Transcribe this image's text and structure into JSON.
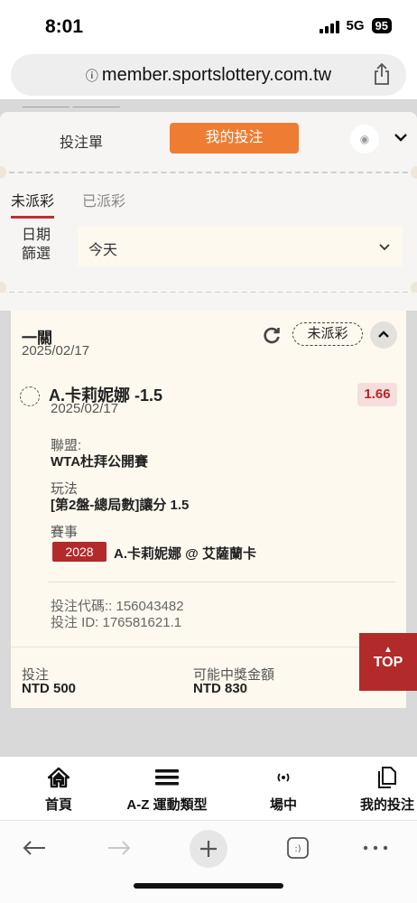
{
  "status_bar": {
    "time": "8:01",
    "network": "5G",
    "battery": "95"
  },
  "browser": {
    "url": "member.sportslottery.com.tw"
  },
  "betslip": {
    "tab_betslip": "投注單",
    "tab_mybets": "我的投注",
    "subtab_unsettled": "未派彩",
    "subtab_settled": "已派彩",
    "date_filter_label": "日期篩選",
    "date_filter_value": "今天"
  },
  "bet": {
    "type": "一關",
    "date": "2025/02/17",
    "status": "未派彩",
    "selection": "A.卡莉妮娜 -1.5",
    "selection_date": "2025/02/17",
    "odds": "1.66",
    "league_label": "聯盟:",
    "league": "WTA杜拜公開賽",
    "market_label": "玩法",
    "market": "[第2盤-總局數]讓分 1.5",
    "event_label": "賽事",
    "event_code": "2028",
    "event_name": "A.卡莉妮娜 @ 艾薩蘭卡",
    "bet_code": "投注代碼:: 156043482",
    "bet_id": "投注 ID: 176581621.1",
    "stake_label": "投注",
    "stake": "NTD 500",
    "payout_label": "可能中獎金額",
    "payout": "NTD 830"
  },
  "top_button": "TOP",
  "bottom_nav": [
    {
      "label": "首頁",
      "icon": "home-icon"
    },
    {
      "label": "A-Z 運動類型",
      "icon": "menu-icon"
    },
    {
      "label": "場中",
      "icon": "live-icon"
    },
    {
      "label": "我的投注",
      "icon": "copy-icon"
    }
  ],
  "colors": {
    "accent": "#ee7d33",
    "red": "#b22a2a",
    "card": "#fdf9ee"
  }
}
